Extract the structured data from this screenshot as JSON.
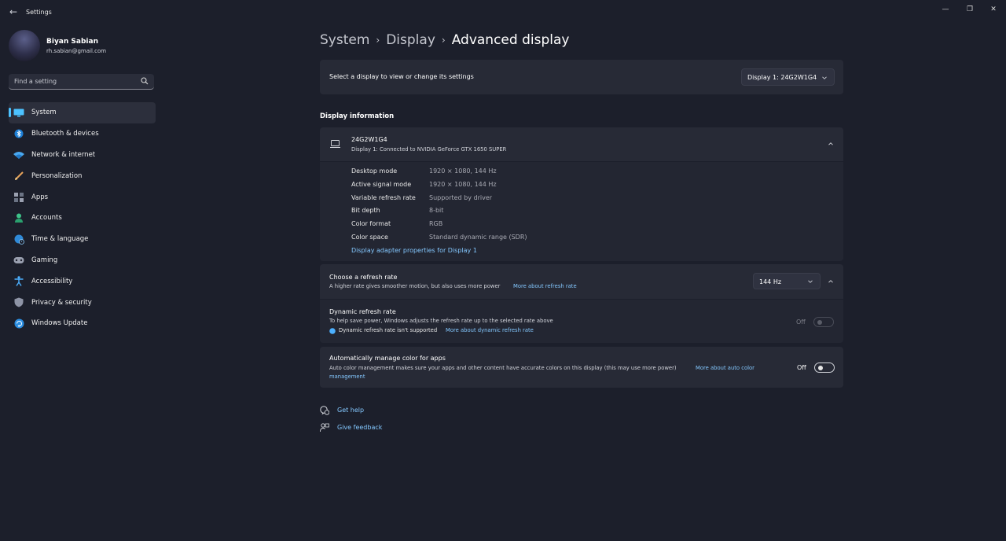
{
  "window": {
    "title": "Settings",
    "minimize_glyph": "—",
    "maximize_glyph": "❐",
    "close_glyph": "✕"
  },
  "user": {
    "name": "Biyan Sabian",
    "email": "rh.sabian@gmail.com"
  },
  "search": {
    "placeholder": "Find a setting",
    "icon": "search-icon"
  },
  "sidebar": {
    "items": [
      {
        "label": "System",
        "icon": "monitor-icon",
        "active": true
      },
      {
        "label": "Bluetooth & devices",
        "icon": "bluetooth-icon"
      },
      {
        "label": "Network & internet",
        "icon": "wifi-icon"
      },
      {
        "label": "Personalization",
        "icon": "brush-icon"
      },
      {
        "label": "Apps",
        "icon": "apps-icon"
      },
      {
        "label": "Accounts",
        "icon": "person-icon"
      },
      {
        "label": "Time & language",
        "icon": "globe-clock-icon"
      },
      {
        "label": "Gaming",
        "icon": "controller-icon"
      },
      {
        "label": "Accessibility",
        "icon": "accessibility-icon"
      },
      {
        "label": "Privacy & security",
        "icon": "shield-icon"
      },
      {
        "label": "Windows Update",
        "icon": "update-icon"
      }
    ]
  },
  "breadcrumb": {
    "items": [
      "System",
      "Display",
      "Advanced display"
    ],
    "separator": "›"
  },
  "display_select": {
    "label": "Select a display to view or change its settings",
    "value": "Display 1: 24G2W1G4"
  },
  "display_info": {
    "section_title": "Display information",
    "monitor_name": "24G2W1G4",
    "monitor_desc": "Display 1: Connected to NVIDIA GeForce GTX 1650 SUPER",
    "rows": [
      {
        "label": "Desktop mode",
        "value": "1920 × 1080, 144 Hz"
      },
      {
        "label": "Active signal mode",
        "value": "1920 × 1080, 144 Hz"
      },
      {
        "label": "Variable refresh rate",
        "value": "Supported by driver"
      },
      {
        "label": "Bit depth",
        "value": "8-bit"
      },
      {
        "label": "Color format",
        "value": "RGB"
      },
      {
        "label": "Color space",
        "value": "Standard dynamic range (SDR)"
      }
    ],
    "adapter_link": "Display adapter properties for Display 1"
  },
  "refresh_rate": {
    "title": "Choose a refresh rate",
    "desc": "A higher rate gives smoother motion, but also uses more power",
    "link": "More about refresh rate",
    "value": "144 Hz"
  },
  "dynamic_refresh": {
    "title": "Dynamic refresh rate",
    "desc": "To help save power, Windows adjusts the refresh rate up to the selected rate above",
    "note": "Dynamic refresh rate isn't supported",
    "link": "More about dynamic refresh rate",
    "state": "Off"
  },
  "auto_color": {
    "title": "Automatically manage color for apps",
    "desc": "Auto color management makes sure your apps and other content have accurate colors on this display (this may use more power)",
    "link_part1": "More about auto color",
    "link_part2": "management",
    "state": "Off"
  },
  "footer": {
    "help": "Get help",
    "feedback": "Give feedback"
  },
  "colors": {
    "background": "#1c1f2b",
    "card": "#272a36",
    "accent": "#4cc2ff",
    "link": "#84c8ff"
  }
}
